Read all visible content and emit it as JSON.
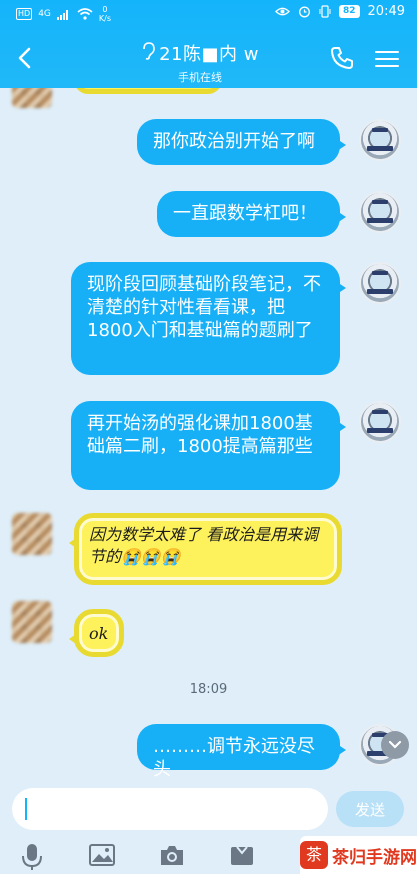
{
  "status_bar": {
    "hd": "HD",
    "signal": "4G",
    "speed_value": "0",
    "speed_unit": "K/s",
    "battery": "82",
    "time": "20:49"
  },
  "header": {
    "title": "21陈■内 w",
    "subtitle": "手机在线"
  },
  "messages": [
    {
      "side": "right",
      "text": "那你政治别开始了啊"
    },
    {
      "side": "right",
      "text": "一直跟数学杠吧！"
    },
    {
      "side": "right",
      "text": "现阶段回顾基础阶段笔记，不清楚的针对性看看课，把1800入门和基础篇的题刷了"
    },
    {
      "side": "right",
      "text": "再开始汤的强化课加1800基础篇二刷，1800提高篇那些"
    },
    {
      "side": "left",
      "text": "因为数学太难了 看政治是用来调节的😭😭😭"
    },
    {
      "side": "left",
      "text": "ok"
    },
    {
      "side": "right",
      "text": "………调节永远没尽头"
    }
  ],
  "timestamp": "18:09",
  "input": {
    "placeholder": "",
    "value": "",
    "send_label": "发送"
  },
  "watermark": {
    "logo": "茶",
    "text": "茶归手游网"
  },
  "icons": {
    "back": "back-arrow-icon",
    "phone": "phone-icon",
    "menu": "menu-icon",
    "mic": "microphone-icon",
    "image": "image-icon",
    "camera": "camera-icon",
    "gift": "gift-icon"
  },
  "colors": {
    "accent": "#14b4fb",
    "bubble": "#17b0f6",
    "lemon": "#fdf15c",
    "background": "#dfeef9"
  }
}
